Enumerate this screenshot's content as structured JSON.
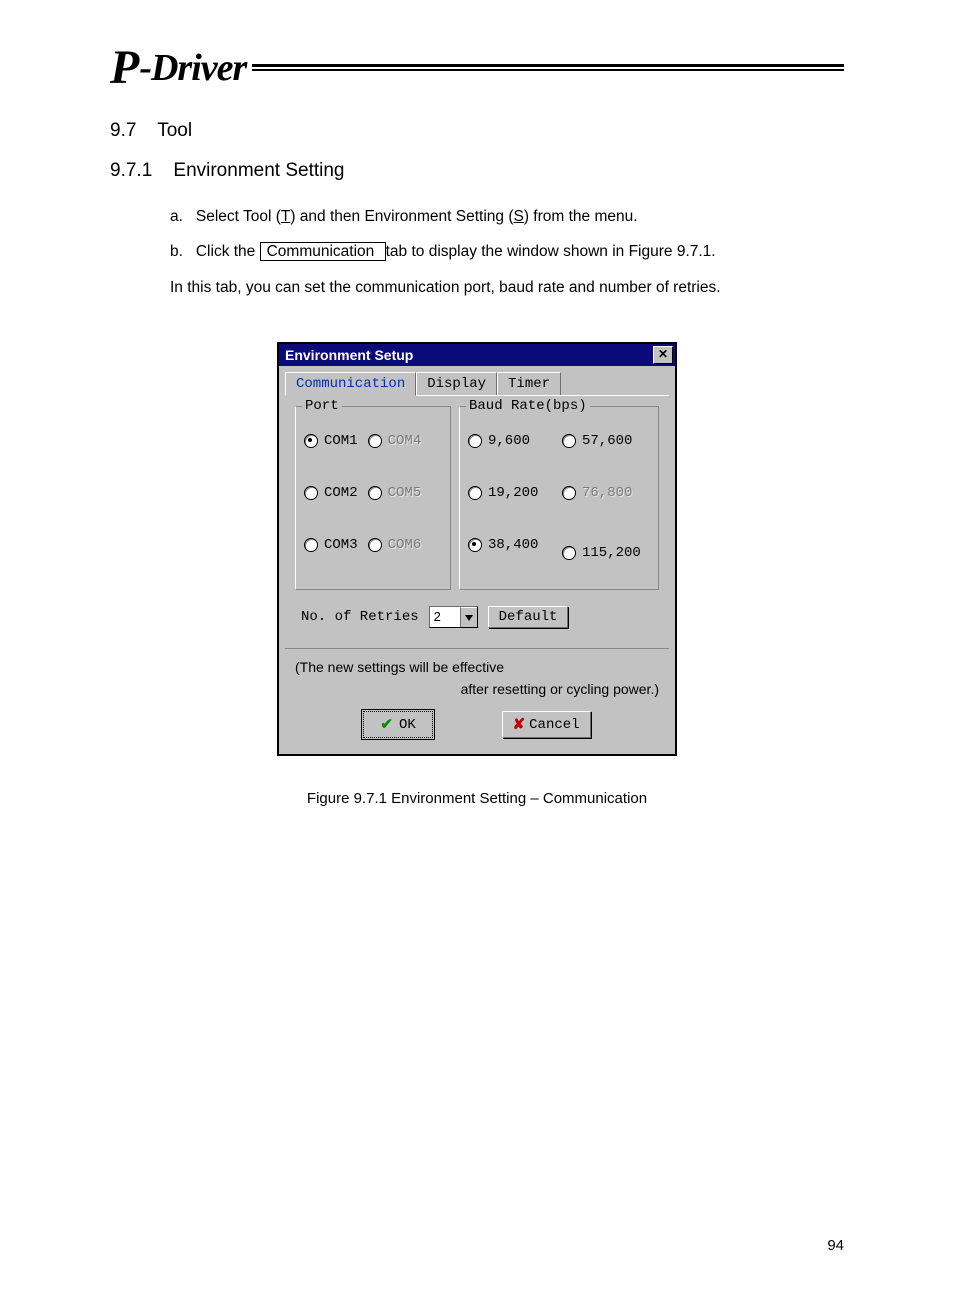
{
  "header": {
    "logo_p": "P",
    "logo_text": "-Driver"
  },
  "section": {
    "num": "9.7",
    "title": "Tool"
  },
  "subsection": {
    "num": "9.7.1",
    "title": "Environment Setting"
  },
  "steps": {
    "a_prefix": "a.",
    "a_1": "Select Tool (",
    "a_T": "T",
    "a_2": ") and then Environment Setting (",
    "a_S": "S",
    "a_3": ") from the menu.",
    "b_prefix": "b.",
    "b_1": "Click the ",
    "b_tab": " Communication ",
    "b_2": " tab to display the window shown in Figure 9.7.1.",
    "b_note": "In this tab, you can set the communication port, baud rate and number of retries."
  },
  "dialog": {
    "title": "Environment Setup",
    "tabs": {
      "t1": "Communication",
      "t2": "Display",
      "t3": "Timer"
    },
    "port": {
      "legend": "Port",
      "items": [
        "COM1",
        "COM2",
        "COM3",
        "COM4",
        "COM5",
        "COM6"
      ],
      "selected": "COM1",
      "disabled": [
        "COM4",
        "COM5",
        "COM6"
      ]
    },
    "baud": {
      "legend": "Baud Rate(bps)",
      "items": [
        "9,600",
        "19,200",
        "38,400",
        "57,600",
        "76,800",
        "115,200"
      ],
      "selected": "38,400",
      "disabled": [
        "76,800"
      ]
    },
    "retries": {
      "label": "No. of Retries",
      "value": "2",
      "default_btn": "Default"
    },
    "note1": "(The new settings will be effective",
    "note2": "after resetting or cycling power.)",
    "ok": "OK",
    "cancel": "Cancel"
  },
  "figure_caption": "Figure 9.7.1    Environment Setting – Communication",
  "page_number": "94"
}
